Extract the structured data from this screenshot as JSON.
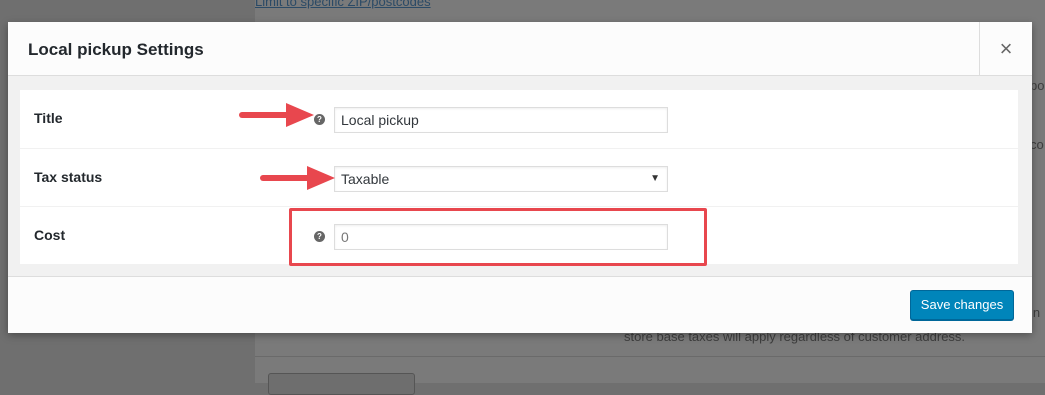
{
  "background": {
    "link_text": "Limit to specific ZIP/postcodes",
    "hint_text": "store base taxes will apply regardless of customer address.",
    "fragments": [
      "po",
      "co",
      "in"
    ]
  },
  "modal": {
    "title": "Local pickup Settings",
    "close_glyph": "×",
    "fields": [
      {
        "label": "Title",
        "value": "Local pickup",
        "has_help": true
      },
      {
        "label": "Tax status",
        "value": "Taxable",
        "type": "select"
      },
      {
        "label": "Cost",
        "value": "0",
        "has_help": true
      }
    ],
    "help_glyph": "?",
    "select_arrow": "▼",
    "save_label": "Save changes"
  },
  "colors": {
    "accent": "#0085ba",
    "annotation": "#e8474e"
  }
}
